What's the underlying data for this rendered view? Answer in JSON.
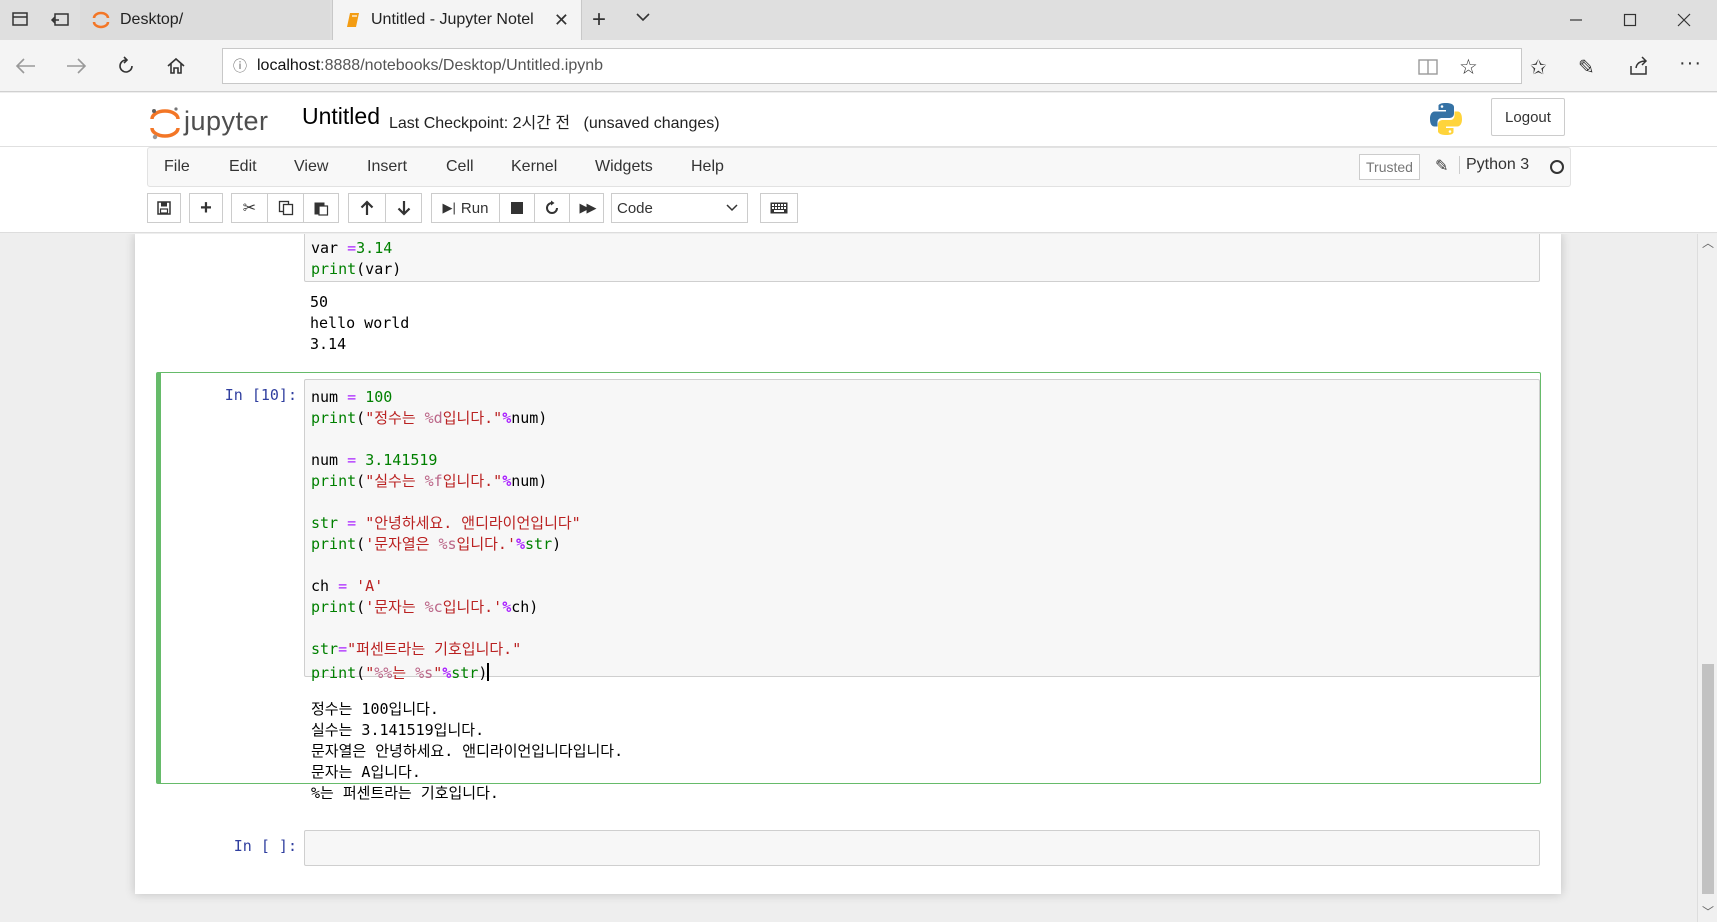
{
  "browser": {
    "tabs": [
      {
        "title": "Desktop/"
      },
      {
        "title": "Untitled - Jupyter Notel"
      }
    ],
    "url_host": "localhost",
    "url_path": ":8888/notebooks/Desktop/Untitled.ipynb"
  },
  "header": {
    "logo_text": "jupyter",
    "notebook_name": "Untitled",
    "checkpoint": "Last Checkpoint: 2시간 전",
    "unsaved": "(unsaved changes)",
    "logout_label": "Logout"
  },
  "menu": {
    "items": [
      "File",
      "Edit",
      "View",
      "Insert",
      "Cell",
      "Kernel",
      "Widgets",
      "Help"
    ],
    "trusted": "Trusted",
    "kernel_name": "Python 3"
  },
  "toolbar": {
    "run_label": "Run",
    "cell_type": "Code"
  },
  "cells": {
    "prev": {
      "code": [
        "var =3.14",
        "print(var)"
      ],
      "output": [
        "50",
        "hello world",
        "3.14"
      ]
    },
    "current": {
      "prompt": "In [10]:",
      "output": [
        "정수는 100입니다.",
        "실수는 3.141519입니다.",
        "문자열은 안녕하세요. 앤디라이언입니다입니다.",
        "문자는 A입니다.",
        "%는 퍼센트라는 기호입니다."
      ]
    },
    "empty": {
      "prompt": "In [ ]:"
    }
  },
  "colors": {
    "selected_border": "#66bb6a",
    "prompt_blue": "#303f9f",
    "keyword_green": "#008000",
    "string_red": "#ba2121",
    "operator_purple": "#aa22ff"
  }
}
